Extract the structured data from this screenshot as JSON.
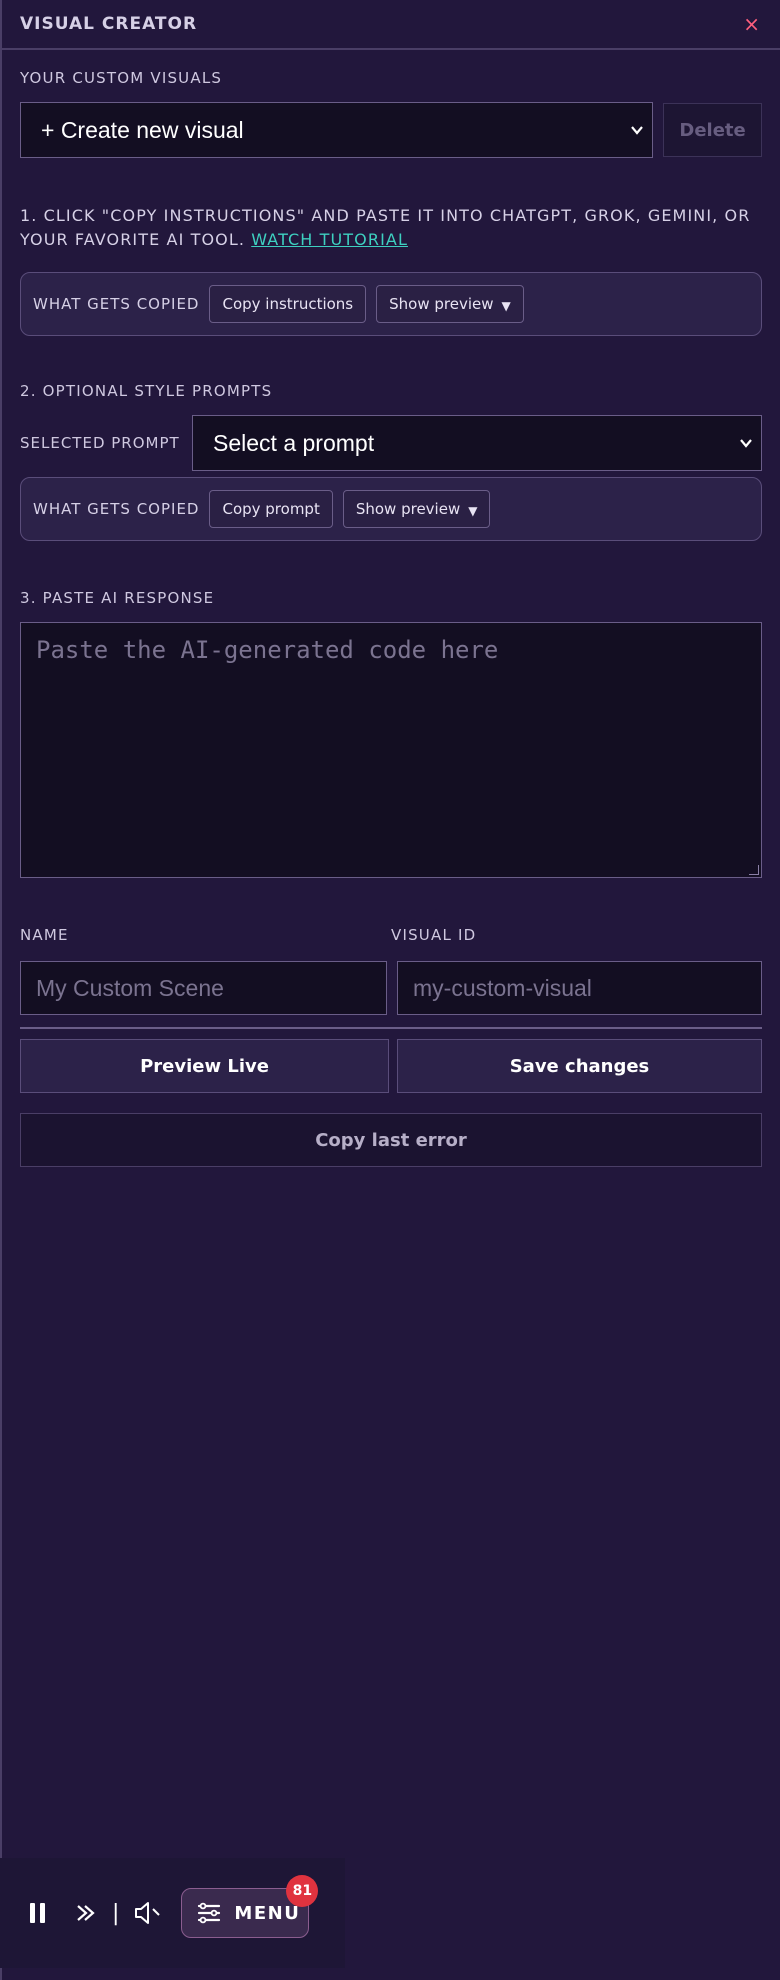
{
  "header": {
    "title": "VISUAL CREATOR",
    "close_label": "×"
  },
  "custom_visuals": {
    "label": "YOUR CUSTOM VISUALS",
    "selected": "+ Create new visual",
    "delete_label": "Delete"
  },
  "step1": {
    "text": "1. CLICK \"COPY INSTRUCTIONS\" AND PASTE IT INTO CHATGPT, GROK, GEMINI, OR YOUR FAVORITE AI TOOL.",
    "link_label": "WATCH TUTORIAL",
    "copy_label": "WHAT GETS COPIED",
    "copy_button": "Copy instructions",
    "preview_button": "Show preview",
    "preview_arrow": "▼"
  },
  "step2": {
    "heading": "2. OPTIONAL STYLE PROMPTS",
    "selected_label": "SELECTED PROMPT",
    "selected": "Select a prompt",
    "copy_label": "WHAT GETS COPIED",
    "copy_button": "Copy prompt",
    "preview_button": "Show preview",
    "preview_arrow": "▼"
  },
  "step3": {
    "heading": "3. PASTE AI RESPONSE",
    "placeholder": "Paste the AI-generated code here"
  },
  "fields": {
    "name_label": "NAME",
    "name_placeholder": "My Custom Scene",
    "id_label": "VISUAL ID",
    "id_placeholder": "my-custom-visual"
  },
  "actions": {
    "preview": "Preview Live",
    "save": "Save changes",
    "copy_error": "Copy last error"
  },
  "player": {
    "separator": "|",
    "menu_label": "MENU",
    "badge_count": "81"
  },
  "colors": {
    "background": "#22173c",
    "accent_link": "#3ed0c0",
    "close": "#ff5f7d",
    "badge": "#e0333f"
  }
}
